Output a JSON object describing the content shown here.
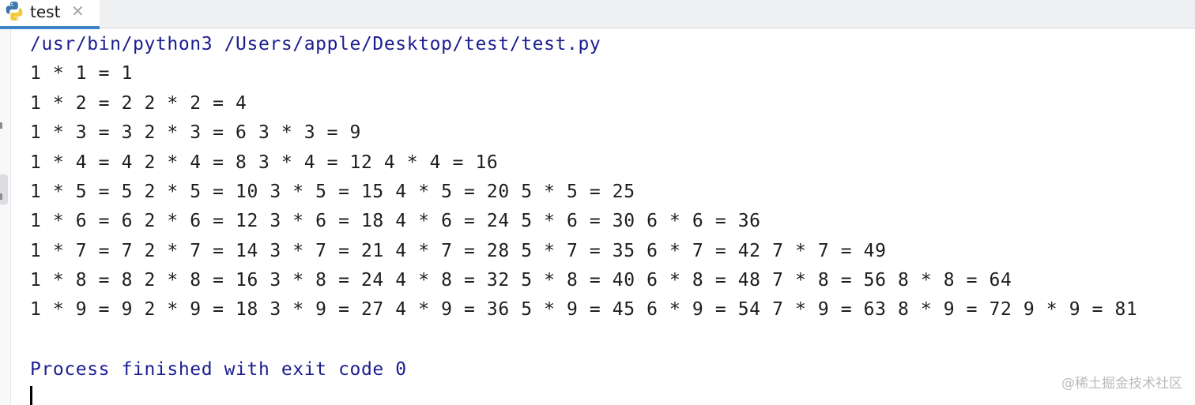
{
  "tab": {
    "icon": "python-icon",
    "title": "test",
    "close_glyph": "✕"
  },
  "console": {
    "command": "/usr/bin/python3 /Users/apple/Desktop/test/test.py",
    "lines": [
      "1 * 1 = 1",
      "1 * 2 = 2 2 * 2 = 4",
      "1 * 3 = 3 2 * 3 = 6 3 * 3 = 9",
      "1 * 4 = 4 2 * 4 = 8 3 * 4 = 12 4 * 4 = 16",
      "1 * 5 = 5 2 * 5 = 10 3 * 5 = 15 4 * 5 = 20 5 * 5 = 25",
      "1 * 6 = 6 2 * 6 = 12 3 * 6 = 18 4 * 6 = 24 5 * 6 = 30 6 * 6 = 36",
      "1 * 7 = 7 2 * 7 = 14 3 * 7 = 21 4 * 7 = 28 5 * 7 = 35 6 * 7 = 42 7 * 7 = 49",
      "1 * 8 = 8 2 * 8 = 16 3 * 8 = 24 4 * 8 = 32 5 * 8 = 40 6 * 8 = 48 7 * 8 = 56 8 * 8 = 64",
      "1 * 9 = 9 2 * 9 = 18 3 * 9 = 27 4 * 9 = 36 5 * 9 = 45 6 * 9 = 54 7 * 9 = 63 8 * 9 = 72 9 * 9 = 81"
    ],
    "finished": "Process finished with exit code 0"
  },
  "watermark": "@稀土掘金技术社区",
  "colors": {
    "command": "#1b1d8f",
    "output": "#1d1d1f",
    "tab_accent": "#4083c9"
  }
}
